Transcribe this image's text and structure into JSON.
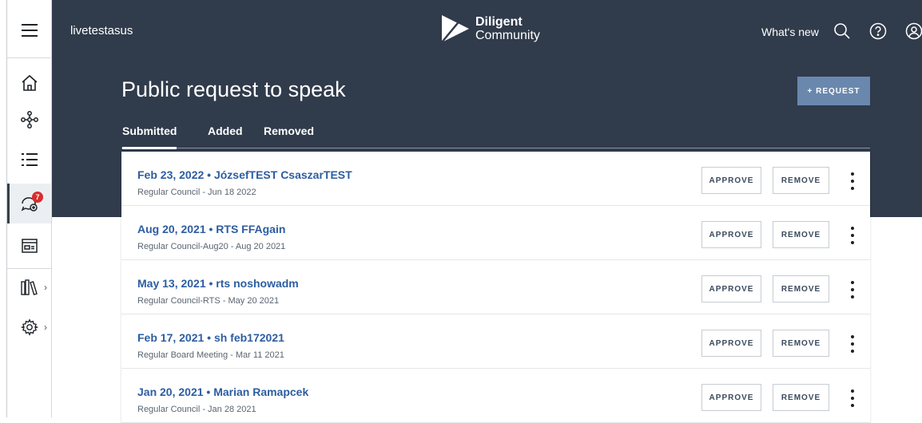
{
  "header": {
    "org_name": "livetestasus",
    "logo_line1": "Diligent",
    "logo_line2": "Community",
    "whats_new": "What's new"
  },
  "sidebar": {
    "badge_count": "7",
    "items": [
      {
        "icon": "menu-icon"
      },
      {
        "icon": "home-icon"
      },
      {
        "icon": "network-icon"
      },
      {
        "icon": "list-icon"
      },
      {
        "icon": "speech-bubble-add-icon"
      },
      {
        "icon": "calendar-panel-icon"
      },
      {
        "icon": "library-icon"
      },
      {
        "icon": "gear-icon"
      }
    ]
  },
  "page": {
    "title": "Public request to speak",
    "request_button": "+ REQUEST",
    "tabs": [
      {
        "label": "Submitted",
        "active": true
      },
      {
        "label": "Added",
        "active": false
      },
      {
        "label": "Removed",
        "active": false
      }
    ]
  },
  "actions": {
    "approve": "APPROVE",
    "remove": "REMOVE"
  },
  "requests": [
    {
      "title": "Feb 23, 2022 • JózsefTEST CsaszarTEST",
      "subtitle": "Regular Council - Jun 18 2022"
    },
    {
      "title": "Aug 20, 2021 • RTS FFAgain",
      "subtitle": "Regular Council-Aug20 - Aug 20 2021"
    },
    {
      "title": "May 13, 2021 • rts noshowadm",
      "subtitle": "Regular Council-RTS - May 20 2021"
    },
    {
      "title": "Feb 17, 2021 • sh feb172021",
      "subtitle": "Regular Board Meeting - Mar 11 2021"
    },
    {
      "title": "Jan 20, 2021 • Marian Ramapcek",
      "subtitle": "Regular Council - Jan 28 2021"
    }
  ],
  "colors": {
    "header_bg": "#303b4b",
    "accent_button": "#6a88ae",
    "link_blue": "#2d5da1",
    "badge_red": "#d92d2d"
  }
}
